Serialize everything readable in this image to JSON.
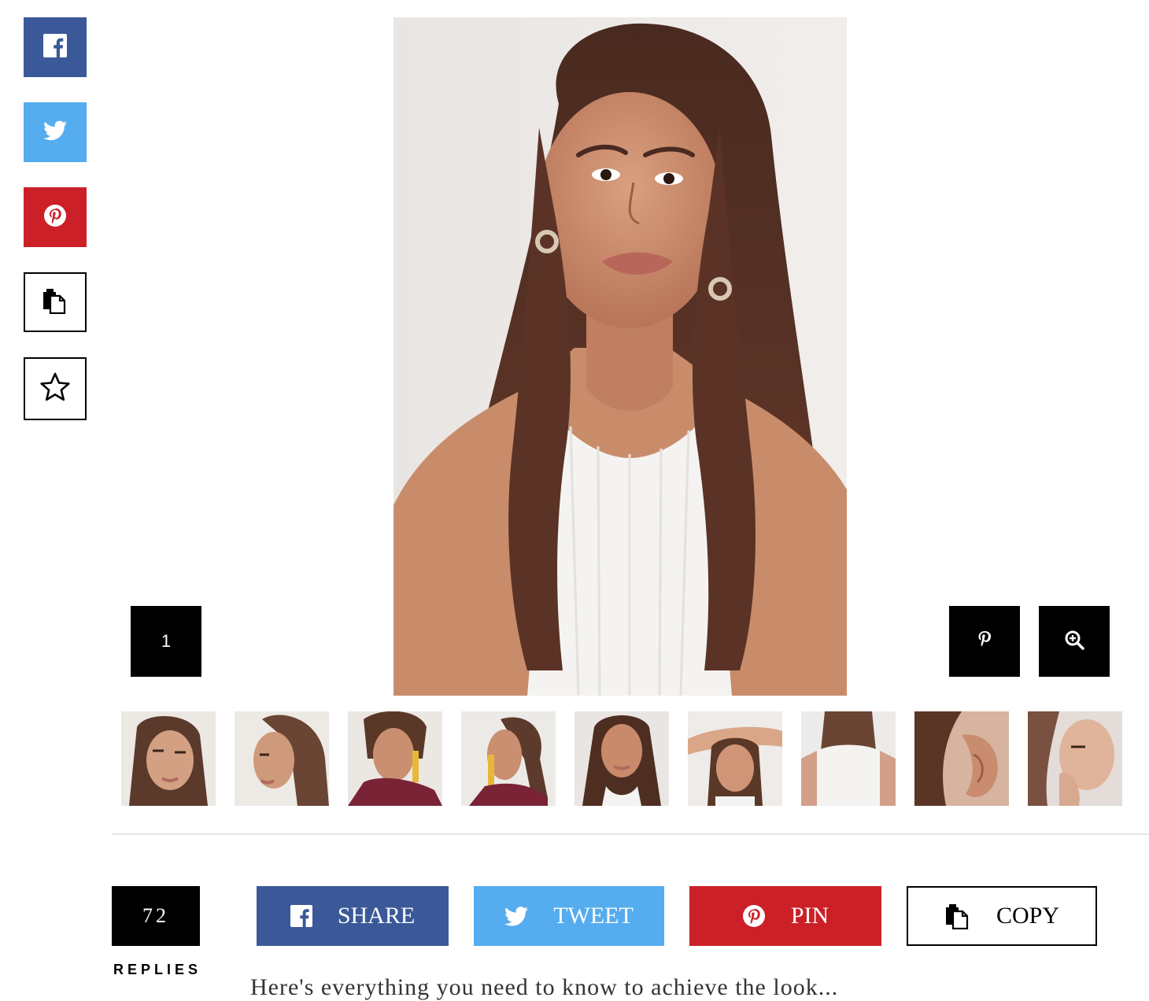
{
  "rail": {
    "items": [
      {
        "id": "facebook",
        "icon": "facebook-icon",
        "color": "#3b5998"
      },
      {
        "id": "twitter",
        "icon": "twitter-icon",
        "color": "#55acee"
      },
      {
        "id": "pinterest",
        "icon": "pinterest-icon",
        "color": "#cb2027"
      },
      {
        "id": "copy",
        "icon": "copy-icon",
        "color": "#ffffff"
      },
      {
        "id": "favorite",
        "icon": "star-icon",
        "color": "#ffffff"
      }
    ]
  },
  "gallery": {
    "current_index": "1",
    "thumbnail_count": 9,
    "selected_thumbnail": 5,
    "pin_icon": "pinterest-icon",
    "zoom_icon": "zoom-in-icon"
  },
  "share_bar": {
    "reply_count": "72",
    "replies_label": "REPLIES",
    "share_label": "SHARE",
    "tweet_label": "TWEET",
    "pin_label": "PIN",
    "copy_label": "COPY"
  },
  "teaser": {
    "text": "Here's everything you need to know to achieve the look..."
  },
  "colors": {
    "facebook": "#3b5998",
    "twitter": "#55acee",
    "pinterest": "#cb2027",
    "dark": "#000000"
  }
}
